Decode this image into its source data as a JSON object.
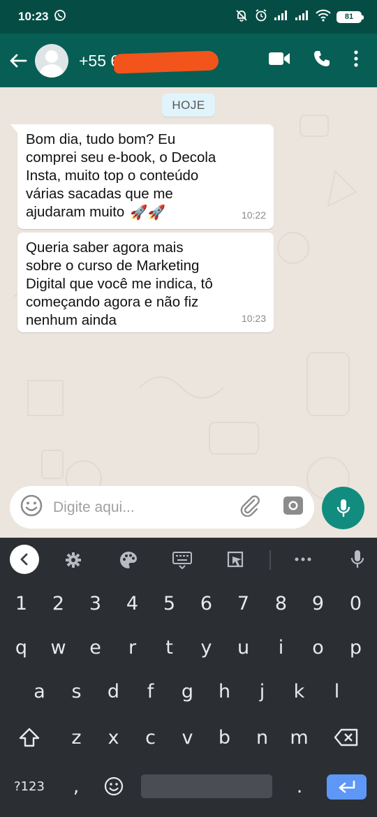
{
  "status_bar": {
    "time": "10:23",
    "battery": "81"
  },
  "header": {
    "contact_name": "+55 6"
  },
  "chat": {
    "date_chip": "HOJE",
    "messages": [
      {
        "lines": [
          "Bom dia, tudo bom? Eu",
          "comprei seu e-book, o Decola",
          "Insta, muito top o conteúdo",
          "várias sacadas que me",
          "ajudaram muito"
        ],
        "emoji": "🚀🚀",
        "time": "10:22"
      },
      {
        "lines": [
          "Queria saber agora mais",
          "sobre o curso de Marketing",
          "Digital que você me indica, tô",
          "começando agora e não fiz",
          "nenhum ainda"
        ],
        "time": "10:23"
      }
    ]
  },
  "input": {
    "placeholder": "Digite aqui..."
  },
  "keyboard": {
    "number_row": [
      "1",
      "2",
      "3",
      "4",
      "5",
      "6",
      "7",
      "8",
      "9",
      "0"
    ],
    "row1": [
      "q",
      "w",
      "e",
      "r",
      "t",
      "y",
      "u",
      "i",
      "o",
      "p"
    ],
    "row2": [
      "a",
      "s",
      "d",
      "f",
      "g",
      "h",
      "j",
      "k",
      "l"
    ],
    "row3": [
      "z",
      "x",
      "c",
      "v",
      "b",
      "n",
      "m"
    ],
    "bottom": {
      "symbols": "?123",
      "comma": ",",
      "period": "."
    }
  },
  "colors": {
    "header": "#075e54",
    "status": "#054d44",
    "accent": "#128c7e",
    "enter": "#5e97f6"
  }
}
